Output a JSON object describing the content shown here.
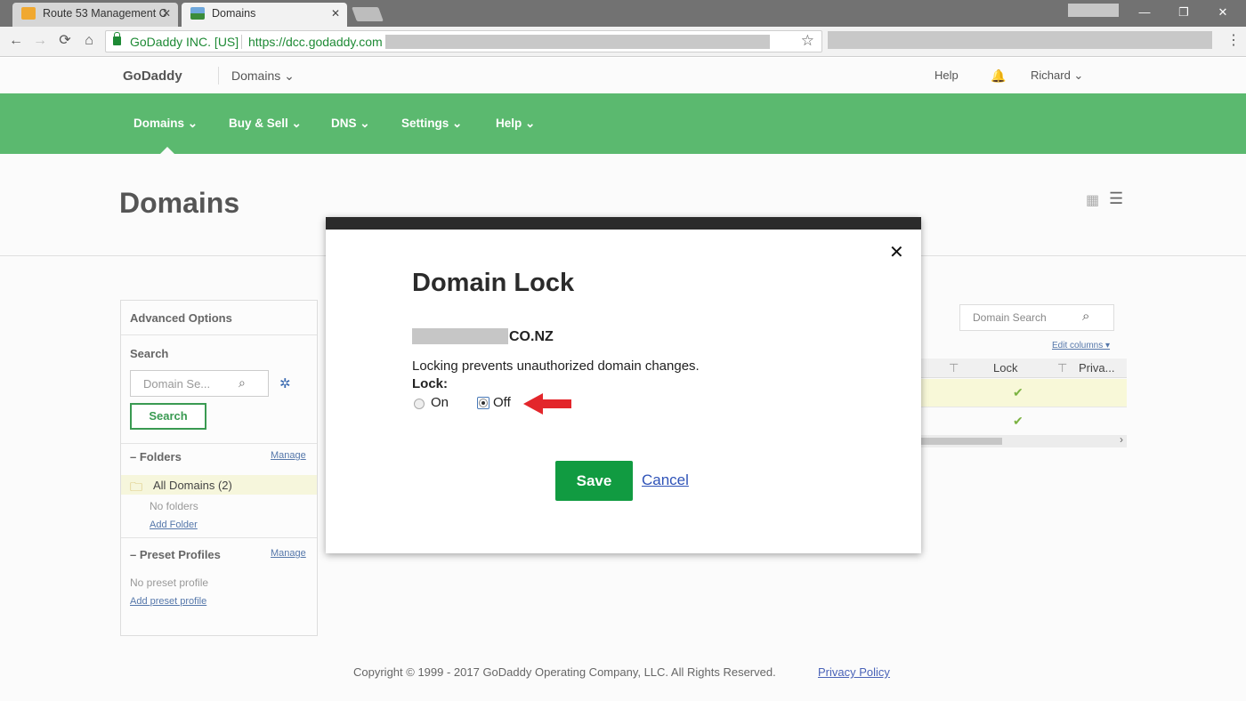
{
  "browser": {
    "tabs": [
      {
        "title": "Route 53 Management C",
        "close": "✕"
      },
      {
        "title": "Domains",
        "close": "✕"
      }
    ],
    "window_controls": {
      "minimize": "—",
      "maximize": "❐",
      "close": "✕"
    },
    "nav": {
      "back": "←",
      "forward": "→",
      "reload": "⟳",
      "home": "⌂"
    },
    "security_label": "GoDaddy INC. [US]",
    "url": "https://dcc.godaddy.com",
    "star": "☆",
    "menu": "⋮"
  },
  "header": {
    "logo": "GoDaddy",
    "product": "Domains ⌄",
    "help": "Help",
    "bell": "🔔",
    "user": "Richard ⌄"
  },
  "nav": {
    "items": [
      {
        "label": "Domains ⌄"
      },
      {
        "label": "Buy & Sell ⌄"
      },
      {
        "label": "DNS ⌄"
      },
      {
        "label": "Settings ⌄"
      },
      {
        "label": "Help ⌄"
      }
    ]
  },
  "page": {
    "title": "Domains",
    "view_grid": "▦",
    "view_list": "☰"
  },
  "sidebar": {
    "advanced_options": "Advanced Options",
    "search_label": "Search",
    "search_placeholder": "Domain Se...",
    "search_icon": "⌕",
    "gear_icon": "✲",
    "search_button": "Search",
    "folders": "– Folders",
    "manage": "Manage",
    "folder_icon": "🗀",
    "all_domains": "All Domains (2)",
    "no_folders": "No folders",
    "add_folder": "Add Folder",
    "preset_profiles": "– Preset Profiles",
    "no_preset": "No preset profile",
    "add_preset": "Add preset profile"
  },
  "table": {
    "search_placeholder": "Domain Search",
    "search_icon": "⌕",
    "edit_columns": "Edit columns ▾",
    "col_lock": "Lock",
    "col_privacy": "Priva...",
    "filter_icon": "⊤",
    "check": "✔",
    "scroll_right": "›"
  },
  "footer": {
    "copyright": "Copyright © 1999 - 2017 GoDaddy Operating Company, LLC. All Rights Reserved.",
    "privacy": "Privacy Policy"
  },
  "modal": {
    "close": "✕",
    "title": "Domain Lock",
    "domain_suffix": "CO.NZ",
    "description": "Locking prevents unauthorized domain changes.",
    "lock_label": "Lock:",
    "option_on": "On",
    "option_off": "Off",
    "selected": "Off",
    "save": "Save",
    "cancel": "Cancel"
  },
  "colors": {
    "brand_green": "#119b41",
    "nav_green": "#5bb96f",
    "arrow_red": "#e3262b",
    "link_blue": "#2f53b8"
  }
}
